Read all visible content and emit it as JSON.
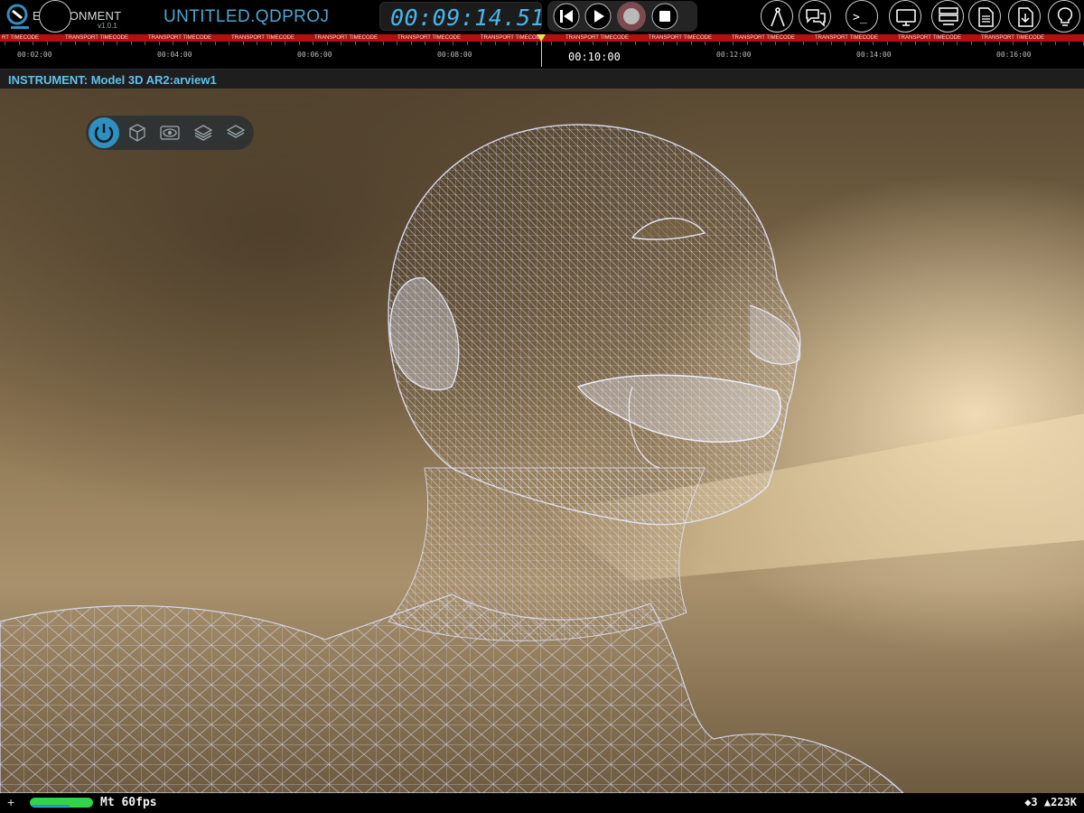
{
  "app": {
    "name": "ENVIRONMENT",
    "version": "v1.0.1",
    "project_title": "UNTITLED.QDPROJ"
  },
  "transport": {
    "timecode": "00:09:14.51",
    "buttons": [
      {
        "name": "skip-back",
        "icon": "skip-back-icon"
      },
      {
        "name": "play",
        "icon": "play-icon"
      },
      {
        "name": "record",
        "icon": "record-icon"
      },
      {
        "name": "stop",
        "icon": "stop-icon"
      }
    ]
  },
  "toolbar_right": {
    "icons": [
      "compass-icon",
      "chat-icon",
      "terminal-icon",
      "monitor-icon",
      "list-monitor-icon",
      "document-icon",
      "download-document-icon",
      "lightbulb-icon"
    ],
    "terminal_glyph": ">_"
  },
  "timeline": {
    "strip_label": "TRANSPORT TIMECODE",
    "strip_first_label": "RT TIMECODE",
    "labels": [
      "00:02:00",
      "00:04:00",
      "00:06:00",
      "00:08:00",
      "00:10:00",
      "00:12:00",
      "00:14:00",
      "00:16:00"
    ],
    "current_label": "00:10:00",
    "accent_color": "#b50f0f",
    "playhead_color": "#f0e24c"
  },
  "instrument": {
    "title": "INSTRUMENT: Model 3D AR2:arview1",
    "tools": [
      "power-icon",
      "cube-icon",
      "eye-icon",
      "layers-icon",
      "layers-alt-icon"
    ],
    "accent_color": "#2f8fc0"
  },
  "status": {
    "add_glyph": "+",
    "meter_level": 1.0,
    "fps_label": "Mt 60fps",
    "stats": "◆3 ▲223K"
  }
}
